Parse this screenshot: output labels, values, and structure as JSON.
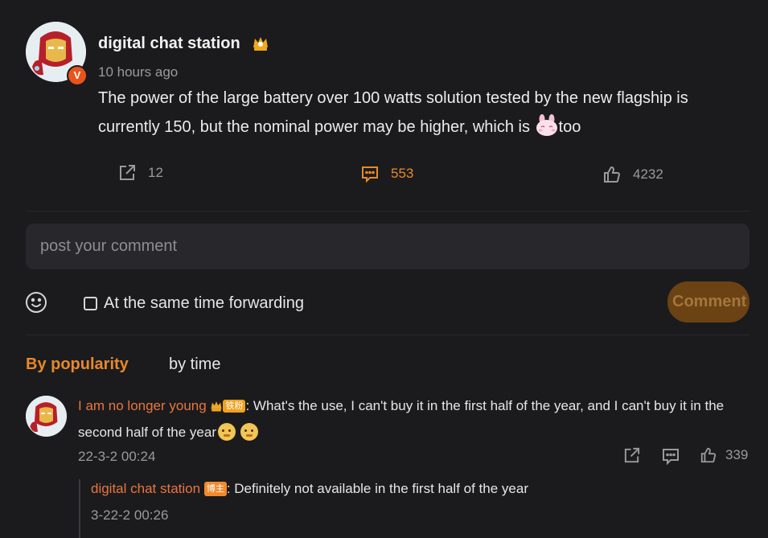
{
  "post": {
    "username": "digital chat station",
    "time": "10 hours ago",
    "text_before_emoji": "The power of the large battery over 100 watts solution tested by the new flagship is currently 150, but the nominal power may be higher, which is ",
    "text_after_emoji": "too",
    "shares": "12",
    "comments": "553",
    "likes": "4232",
    "verified_badge": "V"
  },
  "composer": {
    "placeholder": "post your comment",
    "forward_label": "At the same time forwarding",
    "comment_button": "Comment"
  },
  "sort": {
    "by_popularity": "By popularity",
    "by_time": "by time"
  },
  "comments": [
    {
      "username": "I am no longer young",
      "fan_badge": "铁粉",
      "text": ": What's the use, I can't buy it in the first half of the year, and I can't buy it in the second half of the year",
      "time": "22-3-2 00:24",
      "likes": "339",
      "reply": {
        "username": "digital chat station",
        "host_badge": "博主",
        "text": ": Definitely not available in the first half of the year",
        "time": "3-22-2 00:26"
      }
    }
  ],
  "colors": {
    "background": "#1b1b1d",
    "accent_orange": "#e8892a",
    "username_orange": "#e8763f",
    "button_bg": "#6b4214"
  }
}
